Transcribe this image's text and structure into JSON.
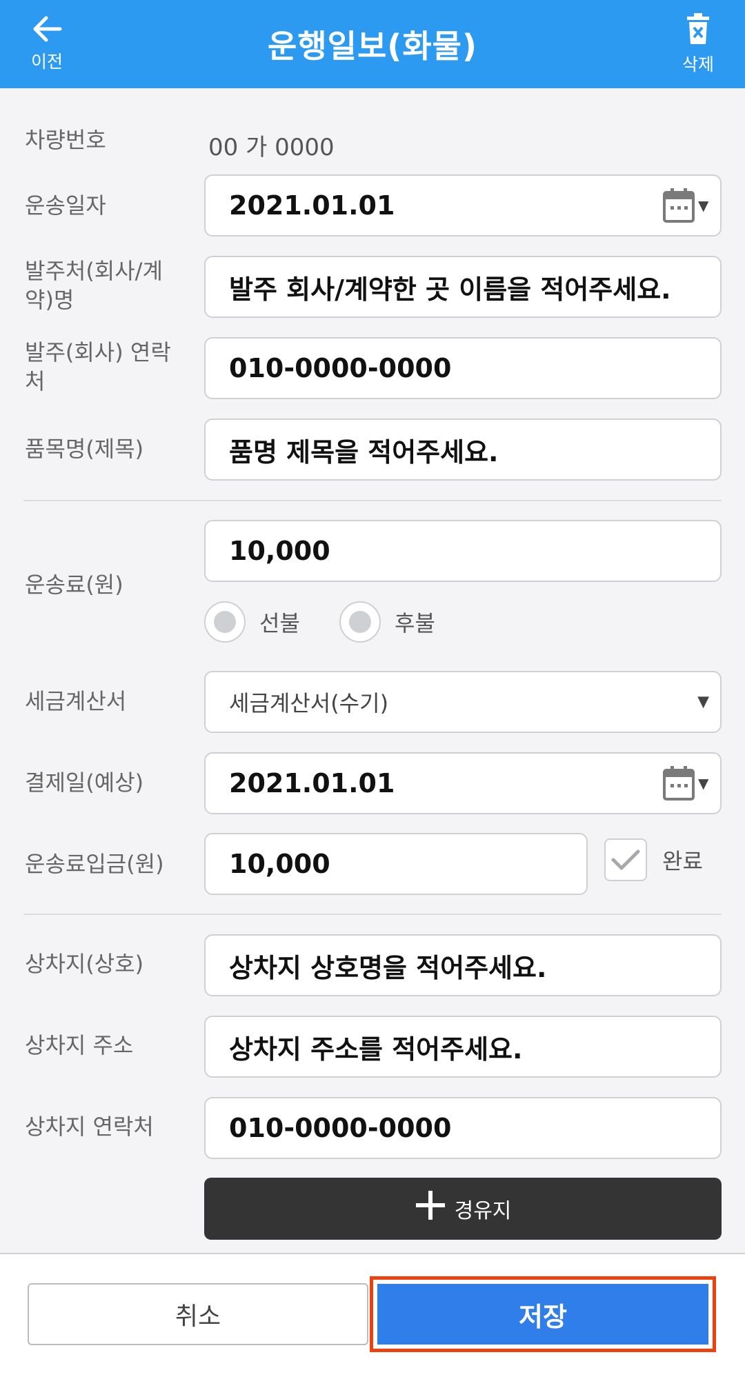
{
  "header": {
    "back_label": "이전",
    "title": "운행일보(화물)",
    "delete_label": "삭제"
  },
  "form": {
    "vehicle_number": {
      "label": "차량번호",
      "value": "00 가 0000"
    },
    "transport_date": {
      "label": "운송일자",
      "value": "2021.01.01"
    },
    "client_name": {
      "label": "발주처(회사/계약)명",
      "placeholder": "발주 회사/계약한 곳 이름을 적어주세요."
    },
    "client_contact": {
      "label": "발주(회사) 연락처",
      "value": "010-0000-0000"
    },
    "item_name": {
      "label": "품목명(제목)",
      "placeholder": "품명 제목을 적어주세요."
    },
    "freight_fee": {
      "label": "운송료(원)",
      "value": "10,000",
      "options": [
        "선불",
        "후불"
      ]
    },
    "tax_invoice": {
      "label": "세금계산서",
      "selected": "세금계산서(수기)"
    },
    "payment_date": {
      "label": "결제일(예상)",
      "value": "2021.01.01"
    },
    "fee_deposit": {
      "label": "운송료입금(원)",
      "value": "10,000",
      "complete_label": "완료"
    },
    "loading_business": {
      "label": "상차지(상호)",
      "placeholder": "상차지 상호명을 적어주세요."
    },
    "loading_address": {
      "label": "상차지 주소",
      "placeholder": "상차지 주소를 적어주세요."
    },
    "loading_contact": {
      "label": "상차지 연락처",
      "value": "010-0000-0000"
    },
    "waypoint_label": "경유지"
  },
  "footer": {
    "cancel_label": "취소",
    "save_label": "저장"
  },
  "colors": {
    "header": "#2d9af2",
    "save_button": "#2f7ee9",
    "highlight": "#f0400e",
    "waypoint_button": "#343434"
  }
}
